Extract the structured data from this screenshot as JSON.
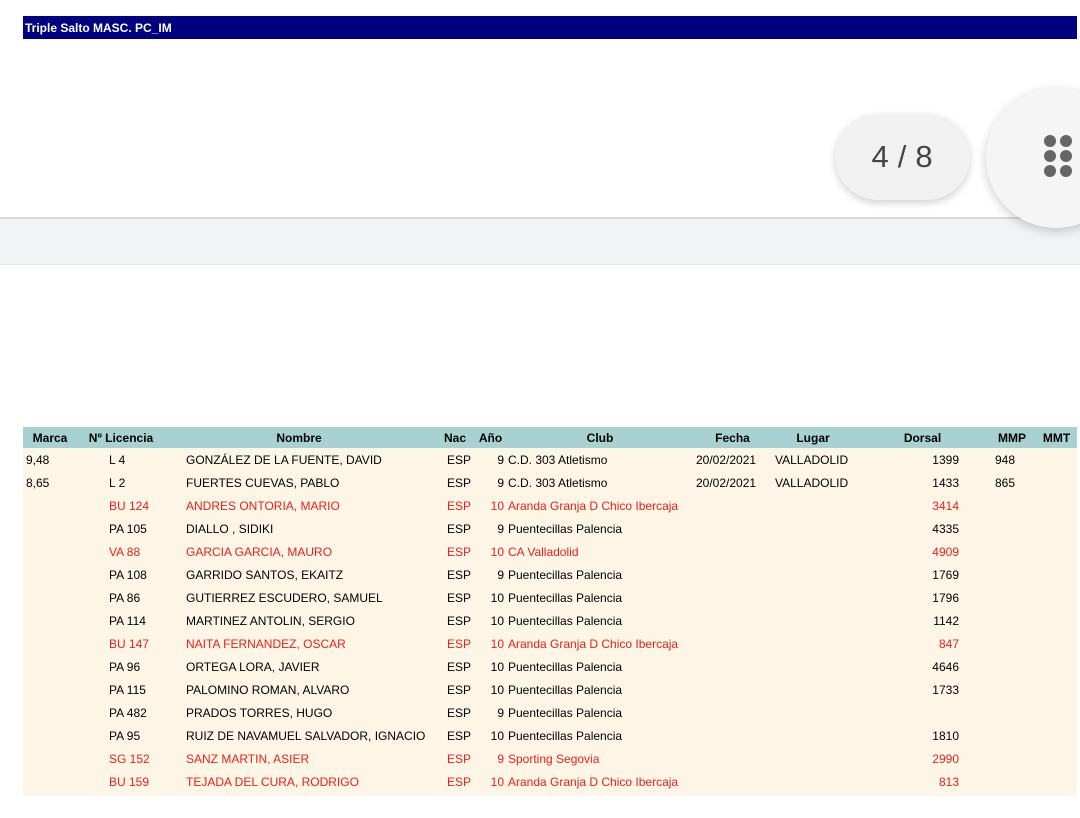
{
  "event_title": "Triple Salto MASC. PC_IM",
  "viewer": {
    "current_page": "4",
    "separator": "/",
    "total_pages": "8"
  },
  "columns": [
    "Marca",
    "Nº Licencia",
    "Nombre",
    "Nac",
    "Año",
    "Club",
    "Fecha",
    "Lugar",
    "Dorsal",
    "MMP",
    "MMT"
  ],
  "rows": [
    {
      "marca": "9,48",
      "licencia": "L 4",
      "nombre": "GONZÁLEZ DE LA FUENTE, DAVID",
      "nac": "ESP",
      "ano": "9",
      "club": "C.D. 303 Atletismo",
      "fecha": "20/02/2021",
      "lugar": "VALLADOLID",
      "dorsal": "1399",
      "mmp": "948",
      "mmt": "",
      "highlight": false
    },
    {
      "marca": "8,65",
      "licencia": "L 2",
      "nombre": "FUERTES CUEVAS, PABLO",
      "nac": "ESP",
      "ano": "9",
      "club": "C.D. 303 Atletismo",
      "fecha": "20/02/2021",
      "lugar": "VALLADOLID",
      "dorsal": "1433",
      "mmp": "865",
      "mmt": "",
      "highlight": false
    },
    {
      "marca": "",
      "licencia": "BU 124",
      "nombre": "ANDRES ONTORIA, MARIO",
      "nac": "ESP",
      "ano": "10",
      "club": "Aranda Granja D Chico Ibercaja",
      "fecha": "",
      "lugar": "",
      "dorsal": "3414",
      "mmp": "",
      "mmt": "",
      "highlight": true
    },
    {
      "marca": "",
      "licencia": "PA 105",
      "nombre": "DIALLO , SIDIKI",
      "nac": "ESP",
      "ano": "9",
      "club": "Puentecillas Palencia",
      "fecha": "",
      "lugar": "",
      "dorsal": "4335",
      "mmp": "",
      "mmt": "",
      "highlight": false
    },
    {
      "marca": "",
      "licencia": "VA 88",
      "nombre": "GARCIA GARCIA, MAURO",
      "nac": "ESP",
      "ano": "10",
      "club": "CA Valladolid",
      "fecha": "",
      "lugar": "",
      "dorsal": "4909",
      "mmp": "",
      "mmt": "",
      "highlight": true
    },
    {
      "marca": "",
      "licencia": "PA 108",
      "nombre": "GARRIDO SANTOS, EKAITZ",
      "nac": "ESP",
      "ano": "9",
      "club": "Puentecillas Palencia",
      "fecha": "",
      "lugar": "",
      "dorsal": "1769",
      "mmp": "",
      "mmt": "",
      "highlight": false
    },
    {
      "marca": "",
      "licencia": "PA 86",
      "nombre": "GUTIERREZ ESCUDERO, SAMUEL",
      "nac": "ESP",
      "ano": "10",
      "club": "Puentecillas Palencia",
      "fecha": "",
      "lugar": "",
      "dorsal": "1796",
      "mmp": "",
      "mmt": "",
      "highlight": false
    },
    {
      "marca": "",
      "licencia": "PA 114",
      "nombre": "MARTINEZ ANTOLIN, SERGIO",
      "nac": "ESP",
      "ano": "10",
      "club": "Puentecillas Palencia",
      "fecha": "",
      "lugar": "",
      "dorsal": "1142",
      "mmp": "",
      "mmt": "",
      "highlight": false
    },
    {
      "marca": "",
      "licencia": "BU 147",
      "nombre": "NAITA FERNANDEZ, OSCAR",
      "nac": "ESP",
      "ano": "10",
      "club": "Aranda Granja D Chico Ibercaja",
      "fecha": "",
      "lugar": "",
      "dorsal": "847",
      "mmp": "",
      "mmt": "",
      "highlight": true
    },
    {
      "marca": "",
      "licencia": "PA 96",
      "nombre": "ORTEGA LORA, JAVIER",
      "nac": "ESP",
      "ano": "10",
      "club": "Puentecillas Palencia",
      "fecha": "",
      "lugar": "",
      "dorsal": "4646",
      "mmp": "",
      "mmt": "",
      "highlight": false
    },
    {
      "marca": "",
      "licencia": "PA 115",
      "nombre": "PALOMINO ROMAN, ALVARO",
      "nac": "ESP",
      "ano": "10",
      "club": "Puentecillas Palencia",
      "fecha": "",
      "lugar": "",
      "dorsal": "1733",
      "mmp": "",
      "mmt": "",
      "highlight": false
    },
    {
      "marca": "",
      "licencia": "PA 482",
      "nombre": "PRADOS TORRES, HUGO",
      "nac": "ESP",
      "ano": "9",
      "club": "Puentecillas Palencia",
      "fecha": "",
      "lugar": "",
      "dorsal": "",
      "mmp": "",
      "mmt": "",
      "highlight": false
    },
    {
      "marca": "",
      "licencia": "PA 95",
      "nombre": "RUIZ DE NAVAMUEL SALVADOR, IGNACIO",
      "nac": "ESP",
      "ano": "10",
      "club": "Puentecillas Palencia",
      "fecha": "",
      "lugar": "",
      "dorsal": "1810",
      "mmp": "",
      "mmt": "",
      "highlight": false
    },
    {
      "marca": "",
      "licencia": "SG 152",
      "nombre": "SANZ MARTIN, ASIER",
      "nac": "ESP",
      "ano": "9",
      "club": "Sporting Segovia",
      "fecha": "",
      "lugar": "",
      "dorsal": "2990",
      "mmp": "",
      "mmt": "",
      "highlight": true
    },
    {
      "marca": "",
      "licencia": "BU 159",
      "nombre": "TEJADA DEL CURA, RODRIGO",
      "nac": "ESP",
      "ano": "10",
      "club": "Aranda Granja D Chico Ibercaja",
      "fecha": "",
      "lugar": "",
      "dorsal": "813",
      "mmp": "",
      "mmt": "",
      "highlight": true
    }
  ],
  "colors": {
    "title_bar": "#000080",
    "header_row": "#a8d1d1",
    "body_bg": "#fdf5e6",
    "highlight_text": "#e8201f"
  },
  "icons": {
    "menu": "grid-dots-icon"
  }
}
